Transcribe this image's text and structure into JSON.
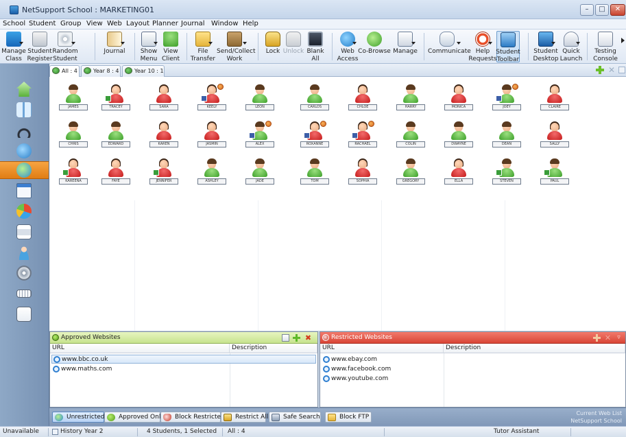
{
  "window": {
    "title": "NetSupport School : MARKETING01",
    "minimize": "–",
    "maximize": "□",
    "close": "✕"
  },
  "menu": [
    "School",
    "Student",
    "Group",
    "View",
    "Web",
    "Layout",
    "Planner",
    "Journal",
    "Window",
    "Help"
  ],
  "toolbar": {
    "buttons": [
      {
        "l1": "Manage",
        "l2": "Class",
        "icon": "manage-class-icon"
      },
      {
        "l1": "Student",
        "l2": "Register",
        "icon": "student-register-icon"
      },
      {
        "l1": "Random",
        "l2": "Student",
        "icon": "random-student-icon"
      },
      {
        "l1": "Journal",
        "l2": "",
        "icon": "journal-icon"
      },
      {
        "l1": "Show",
        "l2": "Menu",
        "icon": "show-icon"
      },
      {
        "l1": "View",
        "l2": "Client",
        "icon": "view-client-icon"
      },
      {
        "l1": "File",
        "l2": "Transfer",
        "icon": "file-transfer-icon"
      },
      {
        "l1": "Send/Collect",
        "l2": "Work",
        "icon": "send-collect-icon"
      },
      {
        "l1": "Lock",
        "l2": "",
        "icon": "lock-icon"
      },
      {
        "l1": "Unlock",
        "l2": "",
        "icon": "unlock-icon"
      },
      {
        "l1": "Blank",
        "l2": "All",
        "icon": "blank-all-icon"
      },
      {
        "l1": "Web",
        "l2": "Access",
        "icon": "web-access-icon"
      },
      {
        "l1": "Co-Browse",
        "l2": "",
        "icon": "co-browse-icon"
      },
      {
        "l1": "Manage",
        "l2": "",
        "icon": "manage-web-icon"
      },
      {
        "l1": "Communicate",
        "l2": "",
        "icon": "communicate-icon"
      },
      {
        "l1": "Help",
        "l2": "Requests",
        "icon": "help-requests-icon"
      },
      {
        "l1": "Student",
        "l2": "Toolbar",
        "icon": "student-toolbar-icon"
      },
      {
        "l1": "Student",
        "l2": "Desktop",
        "icon": "student-desktop-icon"
      },
      {
        "l1": "Quick",
        "l2": "Launch",
        "icon": "quick-launch-icon"
      },
      {
        "l1": "Testing",
        "l2": "Console",
        "icon": "testing-console-icon"
      }
    ]
  },
  "tabs": [
    {
      "label": "All : 4"
    },
    {
      "label": "Year 8 : 4"
    },
    {
      "label": "Year 10 : 1"
    }
  ],
  "students": {
    "row1": [
      "JAMES",
      "TRACEY",
      "SARA",
      "KEELY",
      "LEON",
      "CARLOS",
      "CHLOE",
      "HARRY",
      "MONICA",
      "JOEY",
      "CLAIRE"
    ],
    "row2": [
      "CHRIS",
      "EDWARD",
      "KAREN",
      "JASMIN",
      "ALEX",
      "ROXANNE",
      "RACHAEL",
      "COLIN",
      "DWAYNE",
      "DEAN",
      "SALLY"
    ],
    "row3": [
      "KAREENA",
      "FAYE",
      "JENNIFER",
      "ASHLEY",
      "JADE",
      "TOM",
      "SOPHIA",
      "GREGORY",
      "ELLA",
      "STEVEN",
      "PAUL"
    ]
  },
  "approved": {
    "title": "Approved Websites",
    "col_url": "URL",
    "col_desc": "Description",
    "urls": [
      "www.bbc.co.uk",
      "www.maths.com"
    ]
  },
  "restricted": {
    "title": "Restricted Websites",
    "col_url": "URL",
    "col_desc": "Description",
    "urls": [
      "www.ebay.com",
      "www.facebook.com",
      "www.youtube.com"
    ]
  },
  "web_modes": {
    "unrestricted": "Unrestricted",
    "approved_only": "Approved Only",
    "block_restricted": "Block Restricted",
    "restrict_all": "Restrict All",
    "safe_search": "Safe Search",
    "block_ftp": "Block FTP",
    "status_line1": "Current Web List",
    "status_line2": "NetSupport School"
  },
  "statusbar": {
    "state": "Unavailable",
    "history": "History Year 2",
    "selection": "4 Students, 1 Selected",
    "group": "All : 4",
    "role": "Tutor Assistant"
  },
  "colors": {
    "accent": "#e07d14",
    "approved": "#c7e38e",
    "restricted": "#d94536"
  }
}
